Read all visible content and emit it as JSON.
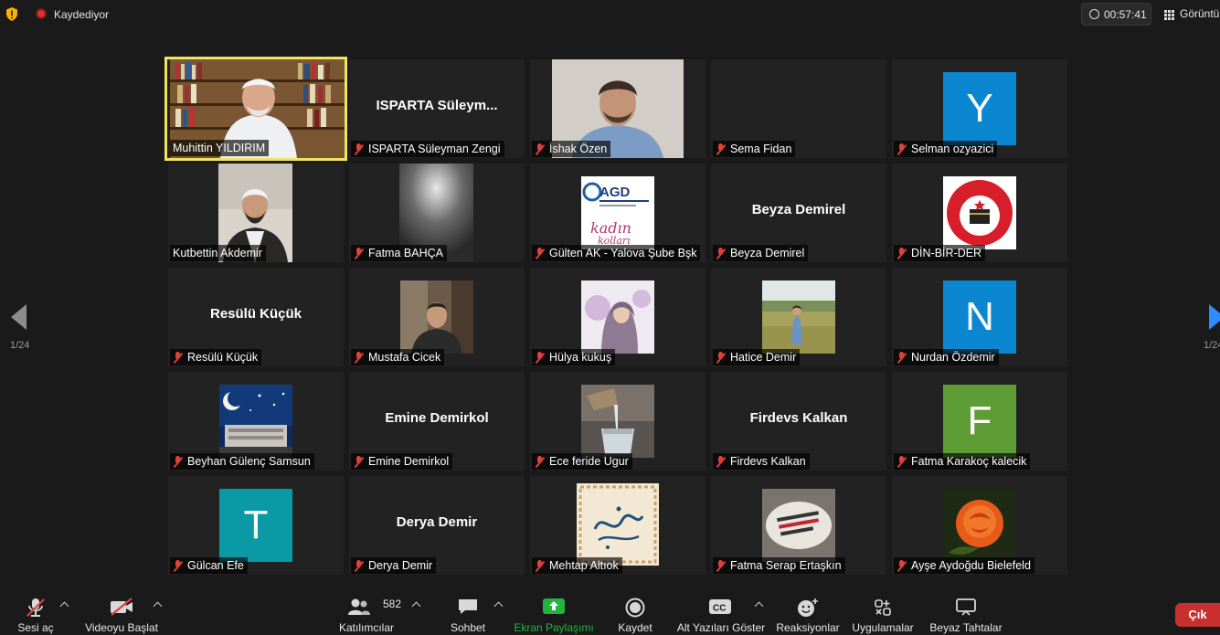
{
  "topbar": {
    "recording_label": "Kaydediyor",
    "timer": "00:57:41",
    "view_label": "Görüntü"
  },
  "pagination": {
    "left": "1/24",
    "right": "1/24"
  },
  "tiles": [
    {
      "name": "Muhittin YILDIRIM",
      "center": "",
      "avatar_letter": "",
      "muted": false,
      "active": true
    },
    {
      "name": "ISPARTA Süleyman Zengi",
      "center": "ISPARTA  Süleym...",
      "avatar_letter": "",
      "muted": true
    },
    {
      "name": "İshak Özen",
      "center": "",
      "avatar_letter": "",
      "muted": true
    },
    {
      "name": "Sema Fidan",
      "center": "",
      "avatar_letter": "",
      "muted": true
    },
    {
      "name": "Selman ozyazici",
      "center": "",
      "avatar_letter": "Y",
      "avatar_color": "#0b86d1",
      "muted": true
    },
    {
      "name": "Kutbettin Akdemir",
      "center": "",
      "avatar_letter": "",
      "muted": false
    },
    {
      "name": "Fatma BAHÇA",
      "center": "",
      "avatar_letter": "",
      "muted": true
    },
    {
      "name": "Gülten AK - Yalova Şube Bşk",
      "center": "",
      "avatar_letter": "",
      "muted": true
    },
    {
      "name": "Beyza Demirel",
      "center": "Beyza Demirel",
      "avatar_letter": "",
      "muted": true
    },
    {
      "name": "DİN-BİR-DER",
      "center": "",
      "avatar_letter": "",
      "muted": true
    },
    {
      "name": "Resülü Küçük",
      "center": "Resülü Küçük",
      "avatar_letter": "",
      "muted": true
    },
    {
      "name": "Mustafa Cicek",
      "center": "",
      "avatar_letter": "",
      "muted": true
    },
    {
      "name": "Hülya kukuş",
      "center": "",
      "avatar_letter": "",
      "muted": true
    },
    {
      "name": "Hatice Demir",
      "center": "",
      "avatar_letter": "",
      "muted": true
    },
    {
      "name": "Nurdan Özdemir",
      "center": "",
      "avatar_letter": "N",
      "avatar_color": "#0b86d1",
      "muted": true
    },
    {
      "name": "Beyhan Gülenç Samsun",
      "center": "",
      "avatar_letter": "",
      "muted": true
    },
    {
      "name": "Emine Demirkol",
      "center": "Emine Demirkol",
      "avatar_letter": "",
      "muted": true
    },
    {
      "name": "Ece feride Ugur",
      "center": "",
      "avatar_letter": "",
      "muted": true
    },
    {
      "name": "Firdevs Kalkan",
      "center": "Firdevs Kalkan",
      "avatar_letter": "",
      "muted": true
    },
    {
      "name": "Fatma Karakoç kalecik",
      "center": "",
      "avatar_letter": "F",
      "avatar_color": "#5e9c35",
      "muted": true
    },
    {
      "name": "Gülcan Efe",
      "center": "",
      "avatar_letter": "T",
      "avatar_color": "#0a9aa6",
      "muted": true
    },
    {
      "name": "Derya Demir",
      "center": "Derya Demir",
      "avatar_letter": "",
      "muted": true
    },
    {
      "name": "Mehtap Altıok",
      "center": "",
      "avatar_letter": "",
      "muted": true
    },
    {
      "name": "Fatma Serap Ertaşkın",
      "center": "",
      "avatar_letter": "",
      "muted": true
    },
    {
      "name": "Ayşe Aydoğdu Bielefeld",
      "center": "",
      "avatar_letter": "",
      "muted": true
    }
  ],
  "toolbar": {
    "unmute": "Sesi aç",
    "start_video": "Videoyu Başlat",
    "participants": "Katılımcılar",
    "participants_count": "582",
    "chat": "Sohbet",
    "share_screen": "Ekran Paylaşımı",
    "record": "Kaydet",
    "captions": "Alt Yazıları Göster",
    "reactions": "Reaksiyonlar",
    "apps": "Uygulamalar",
    "whiteboards": "Beyaz Tahtalar",
    "leave": "Çık"
  },
  "colors": {
    "active_speaker_border": "#f1e45e",
    "share_green": "#25b33f",
    "leave_red": "#c8302f",
    "avatar_blue": "#0b86d1",
    "avatar_green": "#5e9c35",
    "avatar_teal": "#0a9aa6"
  }
}
